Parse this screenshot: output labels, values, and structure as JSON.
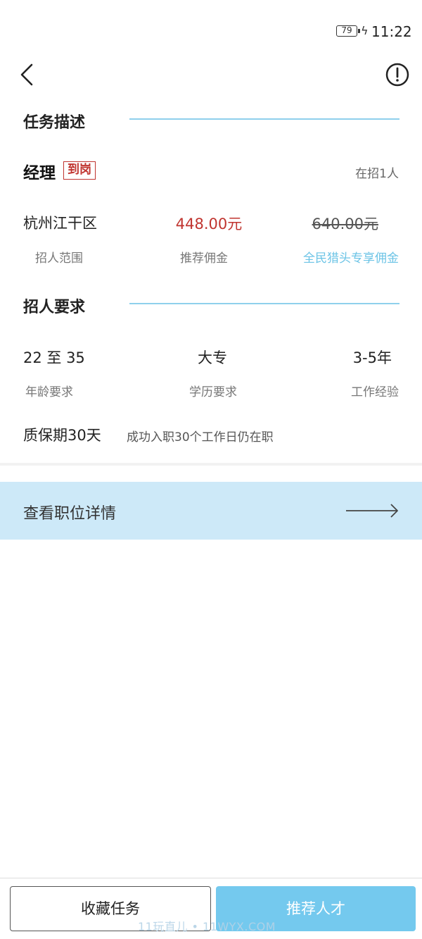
{
  "status_bar": {
    "battery": "79",
    "time": "11:22"
  },
  "header": {
    "back_icon": "chevron-left-icon",
    "info_icon": "exclamation-circle-icon"
  },
  "task_section": {
    "title": "任务描述"
  },
  "job": {
    "title": "经理",
    "badge": "到岗",
    "openings": "在招1人"
  },
  "job_info": {
    "area_value": "杭州江干区",
    "area_label": "招人范围",
    "commission_value": "448.00元",
    "commission_label": "推荐佣金",
    "original_value": "640.00元",
    "original_label": "全民猎头专享佣金"
  },
  "requirements_section": {
    "title": "招人要求"
  },
  "requirements": {
    "age_value": "22 至 35",
    "age_label": "年龄要求",
    "education_value": "大专",
    "education_label": "学历要求",
    "experience_value": "3-5年",
    "experience_label": "工作经验"
  },
  "warranty": {
    "title": "质保期30天",
    "description": "成功入职30个工作日仍在职"
  },
  "details_link": {
    "label": "查看职位详情",
    "icon": "arrow-right-icon"
  },
  "bottom_bar": {
    "favorite_label": "收藏任务",
    "recommend_label": "推荐人才"
  },
  "watermark": "11玩直儿 • 11WYX.COM",
  "colors": {
    "accent_line": "#8fd0ec",
    "commission": "#c0342f",
    "special_label": "#6cc4e6",
    "details_bar": "#cde9f8",
    "recommend_button": "#74c9ee"
  }
}
